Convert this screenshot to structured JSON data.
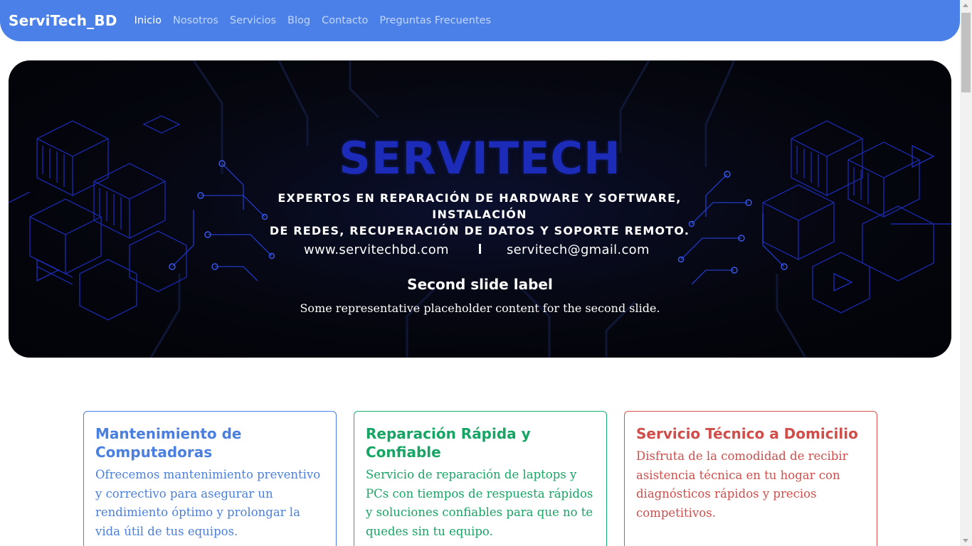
{
  "navbar": {
    "brand": "ServiTech_BD",
    "links": [
      {
        "label": "Inicio",
        "active": true
      },
      {
        "label": "Nosotros",
        "active": false
      },
      {
        "label": "Servicios",
        "active": false
      },
      {
        "label": "Blog",
        "active": false
      },
      {
        "label": "Contacto",
        "active": false
      },
      {
        "label": "Preguntas Frecuentes",
        "active": false
      }
    ]
  },
  "carousel": {
    "brand_title": "SERVITECH",
    "slogan_line1": "EXPERTOS EN REPARACIÓN DE HARDWARE Y SOFTWARE, INSTALACIÓN",
    "slogan_line2": "DE REDES, RECUPERACIÓN DE DATOS Y SOPORTE REMOTO.",
    "website": "www.servitechbd.com",
    "email": "servitech@gmail.com",
    "caption_title": "Second slide label",
    "caption_text": "Some representative placeholder content for the second slide."
  },
  "cards": [
    {
      "title": "Mantenimiento de Computadoras",
      "text": "Ofrecemos mantenimiento preventivo y correctivo para asegurar un rendimiento óptimo y prolongar la vida útil de tus equipos."
    },
    {
      "title": "Reparación Rápida y Confiable",
      "text": "Servicio de reparación de laptops y PCs con tiempos de respuesta rápidos y soluciones confiables para que no te quedes sin tu equipo."
    },
    {
      "title": "Servicio Técnico a Domicilio",
      "text": "Disfruta de la comodidad de recibir asistencia técnica en tu hogar con diagnósticos rápidos y precios competitivos."
    }
  ],
  "colors": {
    "navbar_bg": "#4a80e8",
    "card_blue": "#4a80e8",
    "card_green": "#17b16e",
    "card_red": "#d9534f",
    "brand_title": "#1c2bb8"
  }
}
